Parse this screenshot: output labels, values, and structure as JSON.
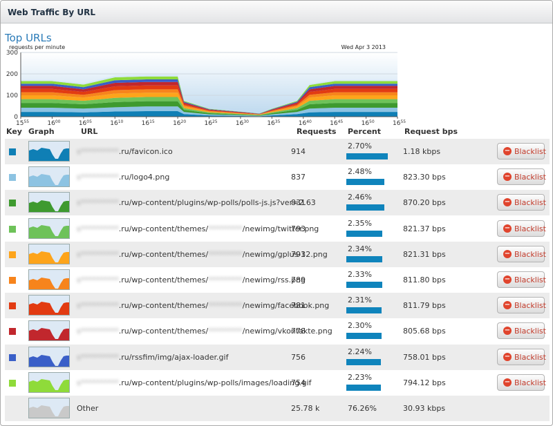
{
  "window": {
    "title": "Web Traffic By URL"
  },
  "section_title": "Top URLs",
  "chart_data": {
    "type": "area",
    "ylabel": "requests per minute",
    "date": "Wed Apr 3 2013",
    "ylim": [
      0,
      300
    ],
    "yticks": [
      "300",
      "200",
      "100",
      "0"
    ],
    "xticks": [
      {
        "h": "15",
        "m": "55"
      },
      {
        "h": "16",
        "m": "00"
      },
      {
        "h": "16",
        "m": "05"
      },
      {
        "h": "16",
        "m": "10"
      },
      {
        "h": "16",
        "m": "15"
      },
      {
        "h": "16",
        "m": "20"
      },
      {
        "h": "16",
        "m": "25"
      },
      {
        "h": "16",
        "m": "30"
      },
      {
        "h": "16",
        "m": "35"
      },
      {
        "h": "16",
        "m": "40"
      },
      {
        "h": "16",
        "m": "45"
      },
      {
        "h": "16",
        "m": "50"
      },
      {
        "h": "16",
        "m": "55"
      }
    ],
    "x": [
      0,
      5,
      10,
      15,
      20,
      25,
      26,
      30,
      36,
      38,
      40,
      44,
      46,
      50,
      55,
      60
    ],
    "series": [
      {
        "color": "#0f7fb5",
        "values": [
          22,
          22,
          20,
          24,
          26,
          26,
          12,
          6,
          3,
          2,
          6,
          12,
          20,
          22,
          22,
          22
        ]
      },
      {
        "color": "#8dc3e2",
        "values": [
          20,
          20,
          18,
          20,
          22,
          22,
          10,
          5,
          3,
          2,
          5,
          10,
          18,
          20,
          20,
          20
        ]
      },
      {
        "color": "#3e9a2f",
        "values": [
          22,
          22,
          20,
          24,
          24,
          24,
          10,
          5,
          3,
          2,
          5,
          10,
          20,
          22,
          22,
          22
        ]
      },
      {
        "color": "#6ec259",
        "values": [
          18,
          18,
          16,
          20,
          20,
          20,
          8,
          4,
          2,
          2,
          4,
          8,
          16,
          18,
          18,
          18
        ]
      },
      {
        "color": "#fda41b",
        "values": [
          18,
          18,
          16,
          20,
          20,
          20,
          8,
          4,
          2,
          2,
          4,
          8,
          16,
          18,
          18,
          18
        ]
      },
      {
        "color": "#f7841c",
        "values": [
          14,
          14,
          12,
          16,
          16,
          16,
          6,
          3,
          2,
          1,
          3,
          6,
          12,
          14,
          14,
          14
        ]
      },
      {
        "color": "#e23b12",
        "values": [
          16,
          16,
          14,
          18,
          18,
          18,
          6,
          3,
          2,
          1,
          3,
          6,
          14,
          16,
          16,
          16
        ]
      },
      {
        "color": "#c1272d",
        "values": [
          14,
          14,
          12,
          16,
          16,
          16,
          6,
          3,
          2,
          1,
          3,
          6,
          12,
          14,
          14,
          14
        ]
      },
      {
        "color": "#3a5fc8",
        "values": [
          10,
          10,
          10,
          12,
          12,
          12,
          4,
          2,
          1,
          1,
          2,
          4,
          10,
          10,
          10,
          10
        ]
      },
      {
        "color": "#8fdb3a",
        "values": [
          12,
          12,
          12,
          14,
          14,
          14,
          4,
          2,
          1,
          1,
          2,
          4,
          10,
          12,
          12,
          12
        ]
      },
      {
        "color": "#d6e9f7",
        "values": [
          6,
          6,
          6,
          8,
          8,
          8,
          2,
          1,
          1,
          0,
          1,
          2,
          6,
          6,
          6,
          6
        ]
      }
    ]
  },
  "table": {
    "headers": {
      "key": "Key",
      "graph": "Graph",
      "url": "URL",
      "requests": "Requests",
      "percent": "Percent",
      "bps": "Request bps"
    },
    "blacklist_label": "Blacklist",
    "rows": [
      {
        "color": "#0f7fb5",
        "blur": "s**********",
        "url": ".ru/favicon.ico",
        "requests": "914",
        "percent": "2.70%",
        "pct_value": 2.7,
        "bps": "1.18 kbps"
      },
      {
        "color": "#8dc3e2",
        "blur": "s**********",
        "url": ".ru/logo4.png",
        "requests": "837",
        "percent": "2.48%",
        "pct_value": 2.48,
        "bps": "823.30 bps"
      },
      {
        "color": "#3e9a2f",
        "blur": "s**********",
        "url": ".ru/wp-content/plugins/wp-polls/polls-js.js?ver=2.63",
        "requests": "831",
        "percent": "2.46%",
        "pct_value": 2.46,
        "bps": "870.20 bps"
      },
      {
        "color": "#6ec259",
        "blur": "s**********",
        "url": ".ru/wp-content/themes/",
        "blur2": "*********",
        "url2": "/newimg/twitter.png",
        "requests": "793",
        "percent": "2.35%",
        "pct_value": 2.35,
        "bps": "821.37 bps"
      },
      {
        "color": "#fda41b",
        "blur": "s**********",
        "url": ".ru/wp-content/themes/",
        "blur2": "*********",
        "url2": "/newimg/gplus-32.png",
        "requests": "791",
        "percent": "2.34%",
        "pct_value": 2.34,
        "bps": "821.31 bps"
      },
      {
        "color": "#f7841c",
        "blur": "s**********",
        "url": ".ru/wp-content/themes/",
        "blur2": "*********",
        "url2": "/newimg/rss.png",
        "requests": "789",
        "percent": "2.33%",
        "pct_value": 2.33,
        "bps": "811.80 bps"
      },
      {
        "color": "#e23b12",
        "blur": "s**********",
        "url": ".ru/wp-content/themes/",
        "blur2": "*********",
        "url2": "/newimg/facebook.png",
        "requests": "781",
        "percent": "2.31%",
        "pct_value": 2.31,
        "bps": "811.79 bps"
      },
      {
        "color": "#c1272d",
        "blur": "s**********",
        "url": ".ru/wp-content/themes/",
        "blur2": "*********",
        "url2": "/newimg/vkontakte.png",
        "requests": "778",
        "percent": "2.30%",
        "pct_value": 2.3,
        "bps": "805.68 bps"
      },
      {
        "color": "#3a5fc8",
        "blur": "s**********",
        "url": ".ru/rssfim/img/ajax-loader.gif",
        "requests": "756",
        "percent": "2.24%",
        "pct_value": 2.24,
        "bps": "758.01 bps"
      },
      {
        "color": "#8fdb3a",
        "blur": "s**********",
        "url": ".ru/wp-content/plugins/wp-polls/images/loading.gif",
        "requests": "754",
        "percent": "2.23%",
        "pct_value": 2.23,
        "bps": "794.12 bps"
      }
    ],
    "other": {
      "color": "#c9c9c9",
      "url": "Other",
      "requests": "25.78 k",
      "percent": "76.26%",
      "bps": "30.93 kbps"
    }
  }
}
